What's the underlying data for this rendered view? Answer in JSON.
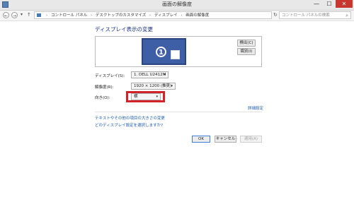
{
  "window": {
    "title": "画面の解像度",
    "min_glyph": "—",
    "max_glyph": "☐",
    "close_glyph": "✕"
  },
  "address": {
    "back_glyph": "←",
    "forward_glyph": "→",
    "up_glyph": "↑",
    "breadcrumbs": [
      "コントロール パネル",
      "デスクトップのカスタマイズ",
      "ディスプレイ",
      "画面の解像度"
    ],
    "separator": "›",
    "refresh_glyph": "↻",
    "search_placeholder": "コントロール パネルの検索",
    "search_glyph": "⌕"
  },
  "main": {
    "heading": "ディスプレイ表示の変更",
    "monitor_number": "1",
    "detect_label": "検出(C)",
    "identify_label": "識別(I)",
    "display_label": "ディスプレイ(S):",
    "display_value": "1. DELL U2412M",
    "resolution_label": "解像度(R):",
    "resolution_value": "1920 × 1200 (推奨)",
    "orientation_label": "向き(O):",
    "orientation_value": "横",
    "advanced_link": "詳細設定",
    "link_text_size": "テキストやその他の項目の大きさの変更",
    "link_which_settings": "どのディスプレイ設定を選択しますか?",
    "dropdown_glyph": "▾"
  },
  "footer": {
    "ok_label": "OK",
    "cancel_label": "キャンセル",
    "apply_label": "適用(A)"
  },
  "colors": {
    "accent": "#1e3287",
    "link": "#1c5aa8",
    "highlight": "#d2222a",
    "monitor": "#3e5ea6",
    "close": "#c7372f"
  }
}
